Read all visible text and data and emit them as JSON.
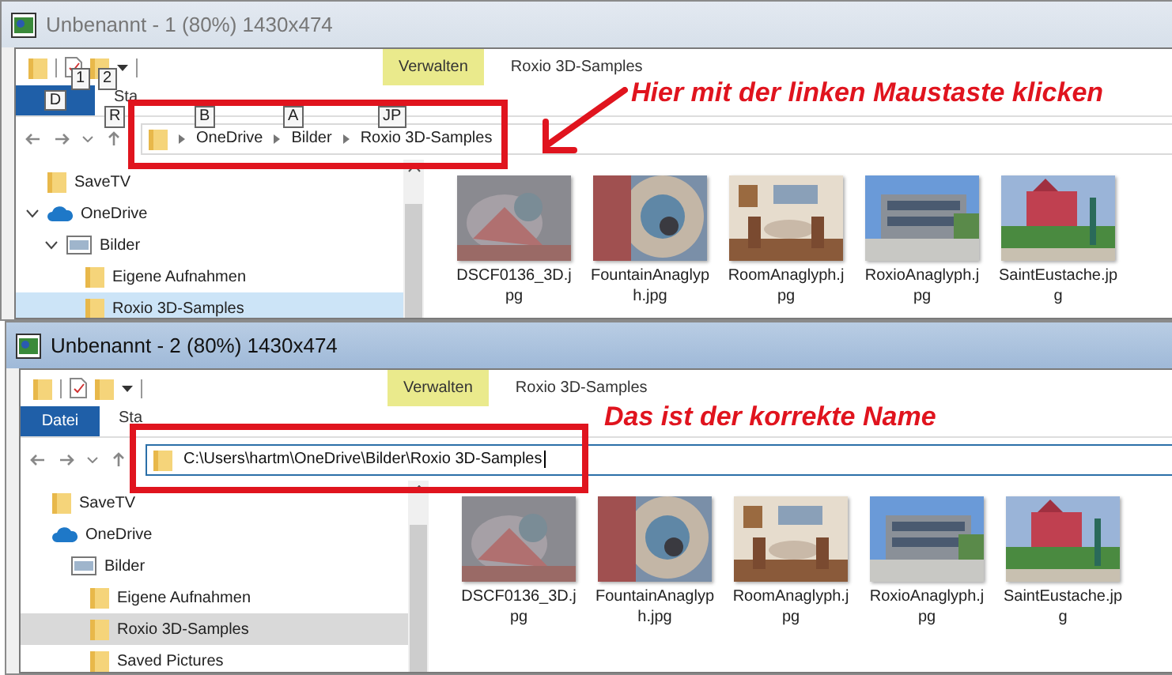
{
  "windows": [
    {
      "title": "Unbenannt - 1 (80%) 1430x474",
      "active": false,
      "keytips": [
        "1",
        "2",
        "R",
        "B",
        "A",
        "JP"
      ],
      "context_tab": {
        "label": "Verwalten"
      },
      "caption": "Roxio 3D-Samples",
      "file_tab": {
        "keytip": "D"
      },
      "tabs": [
        {
          "label": "Sta",
          "selected": false
        }
      ],
      "address": {
        "kind": "breadcrumb",
        "parts": [
          "OneDrive",
          "Bilder",
          "Roxio 3D-Samples"
        ]
      },
      "tree": [
        {
          "label": "SaveTV",
          "kind": "folder",
          "selected": false
        },
        {
          "label": "OneDrive",
          "kind": "cloud",
          "selected": false,
          "expanded": true,
          "children": [
            {
              "label": "Bilder",
              "kind": "library",
              "selected": false,
              "expanded": true,
              "children": [
                {
                  "label": "Eigene Aufnahmen",
                  "kind": "folder",
                  "selected": false
                },
                {
                  "label": "Roxio 3D-Samples",
                  "kind": "folder",
                  "selected": true
                }
              ]
            }
          ]
        }
      ],
      "files": [
        "DSCF0136_3D.jpg",
        "FountainAnaglyph.jpg",
        "RoomAnaglyph.jpg",
        "RoxioAnaglyph.jpg",
        "SaintEustache.jpg"
      ],
      "annotation": "Hier mit der linken Maustaste klicken"
    },
    {
      "title": "Unbenannt - 2 (80%) 1430x474",
      "active": true,
      "context_tab": {
        "label": "Verwalten"
      },
      "caption": "Roxio 3D-Samples",
      "file_tab": {
        "label": "Datei"
      },
      "tabs": [
        {
          "label": "Sta",
          "selected": false
        }
      ],
      "address": {
        "kind": "path",
        "value": "C:\\Users\\hartm\\OneDrive\\Bilder\\Roxio 3D-Samples"
      },
      "tree": [
        {
          "label": "SaveTV",
          "kind": "folder",
          "selected": false
        },
        {
          "label": "OneDrive",
          "kind": "cloud",
          "selected": false,
          "children": [
            {
              "label": "Bilder",
              "kind": "library",
              "selected": false,
              "children": [
                {
                  "label": "Eigene Aufnahmen",
                  "kind": "folder",
                  "selected": false
                },
                {
                  "label": "Roxio 3D-Samples",
                  "kind": "folder",
                  "selected": true
                },
                {
                  "label": "Saved Pictures",
                  "kind": "folder",
                  "selected": false
                }
              ]
            }
          ]
        }
      ],
      "files": [
        "DSCF0136_3D.jpg",
        "FountainAnaglyph.jpg",
        "RoomAnaglyph.jpg",
        "RoxioAnaglyph.jpg",
        "SaintEustache.jpg"
      ],
      "annotation": "Das ist der korrekte Name"
    }
  ]
}
